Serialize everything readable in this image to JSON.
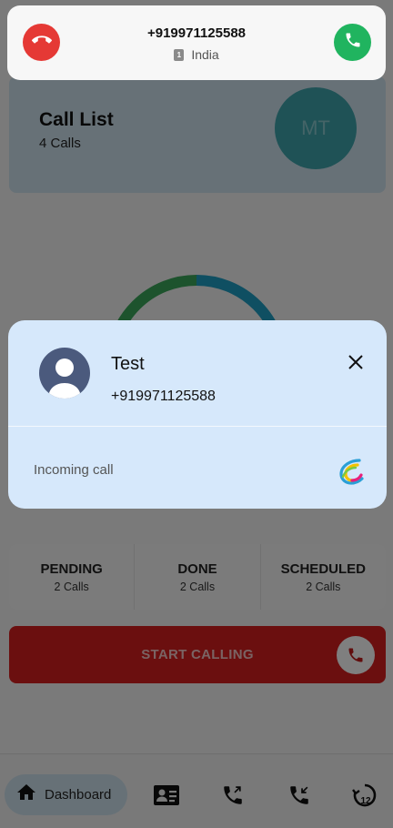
{
  "app": {
    "call_list": {
      "title": "Call List",
      "subtitle": "4 Calls",
      "avatar_initials": "MT"
    },
    "progress_ring": {
      "segments": [
        {
          "name": "done",
          "color": "#3aa75a",
          "fraction": 0.5
        },
        {
          "name": "pending",
          "color": "#1f9fc4",
          "fraction": 0.5
        }
      ]
    },
    "stats": [
      {
        "label": "PENDING",
        "count": "2 Calls"
      },
      {
        "label": "DONE",
        "count": "2 Calls"
      },
      {
        "label": "SCHEDULED",
        "count": "2 Calls"
      }
    ],
    "start_button": {
      "label": "START CALLING",
      "color": "#d61f1f"
    },
    "bottom_nav": {
      "active": {
        "label": "Dashboard",
        "icon": "home-icon"
      },
      "icons": [
        "contact-card-icon",
        "outgoing-call-icon",
        "incoming-call-icon",
        "call-history-12-icon"
      ],
      "badge_number": "12"
    }
  },
  "headsup": {
    "number": "+919971125588",
    "sim_label": "1",
    "country": "India",
    "decline_icon": "phone-hangup-icon",
    "accept_icon": "phone-accept-icon",
    "decline_color": "#e53935",
    "accept_color": "#20b45f"
  },
  "incoming_card": {
    "name": "Test",
    "number": "+919971125588",
    "status": "Incoming call",
    "avatar_icon": "person-avatar-icon",
    "close_icon": "close-icon",
    "logo_icon": "app-logo-icon"
  }
}
